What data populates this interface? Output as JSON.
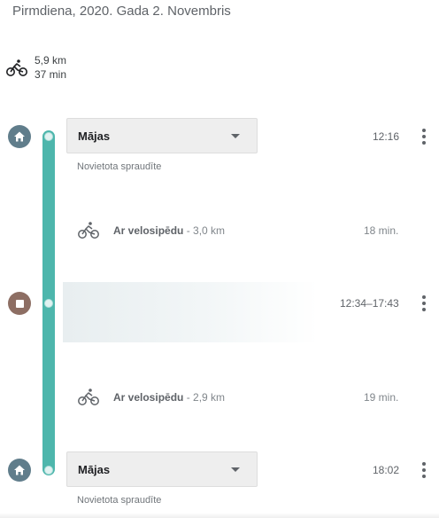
{
  "header": {
    "date": "Pirmdiena, 2020. Gada 2. Novembris"
  },
  "summary": {
    "icon": "bicycle-icon",
    "distance": "5,9 km",
    "duration": "37 min"
  },
  "timeline": {
    "color": "#4db6ac",
    "visits": [
      {
        "icon": "home-icon",
        "place": "Mājas",
        "note": "Novietota spraudīte",
        "time": "12:16"
      },
      {
        "icon": "stop-icon",
        "place": "",
        "time": "12:34–17:43"
      },
      {
        "icon": "home-icon",
        "place": "Mājas",
        "note": "Novietota spraudīte",
        "time": "18:02"
      }
    ],
    "activities": [
      {
        "icon": "bicycle-icon",
        "mode": "Ar velosipēdu",
        "distance": " - 3,0 km",
        "duration": "18 min."
      },
      {
        "icon": "bicycle-icon",
        "mode": "Ar velosipēdu",
        "distance": " - 2,9 km",
        "duration": "19 min."
      }
    ]
  },
  "colors": {
    "home_badge": "#607d8b",
    "stop_badge": "#8d6e63",
    "accent": "#4db6ac"
  }
}
